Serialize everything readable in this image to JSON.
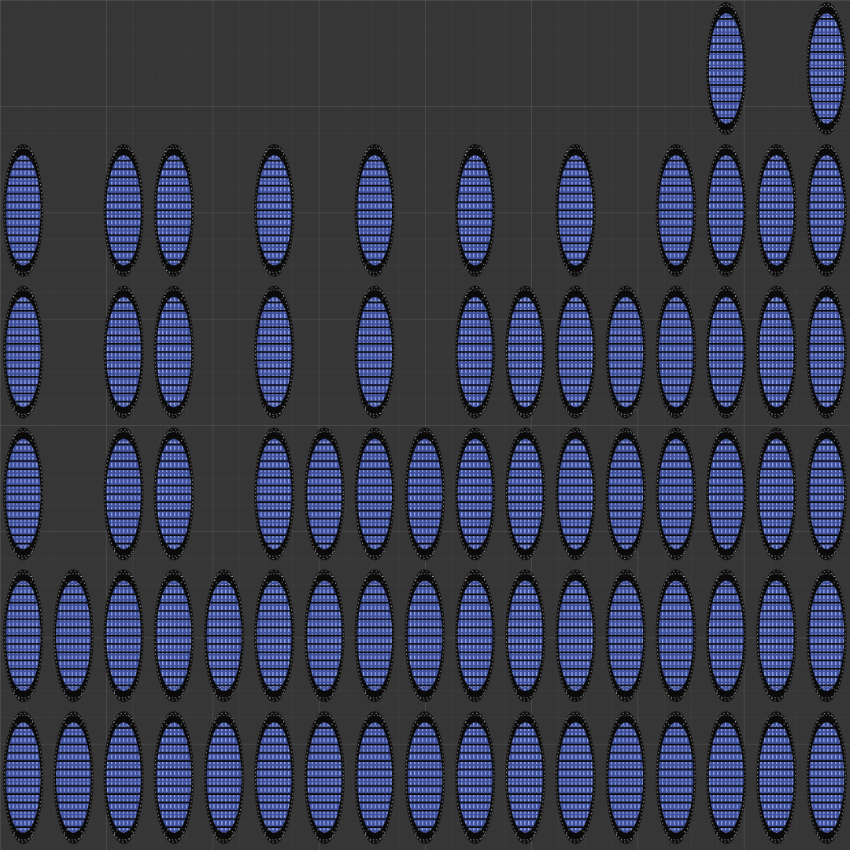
{
  "editor": {
    "name": "uv-editor",
    "background": "#363636",
    "grid_color": "#4a4a4a"
  },
  "island_style": {
    "fill_color": "#3f4f9a",
    "stripe_color": "#7f95d8",
    "edge_color": "#0a0a0a",
    "vertex_color": "#e0e0e0"
  },
  "island_rows": [
    {
      "row": 1,
      "occupied_columns": [
        15,
        17
      ]
    },
    {
      "row": 2,
      "occupied_columns": [
        1,
        3,
        4,
        6,
        8,
        10,
        12,
        14,
        15,
        16,
        17
      ]
    },
    {
      "row": 3,
      "occupied_columns": [
        1,
        3,
        4,
        6,
        8,
        10,
        11,
        12,
        13,
        14,
        15,
        16,
        17
      ]
    },
    {
      "row": 4,
      "occupied_columns": [
        1,
        3,
        4,
        6,
        7,
        8,
        9,
        10,
        11,
        12,
        13,
        14,
        15,
        16,
        17
      ]
    },
    {
      "row": 5,
      "occupied_columns": [
        1,
        2,
        3,
        4,
        5,
        6,
        7,
        8,
        9,
        10,
        11,
        12,
        13,
        14,
        15,
        16,
        17
      ]
    },
    {
      "row": 6,
      "occupied_columns": [
        1,
        2,
        3,
        4,
        5,
        6,
        7,
        8,
        9,
        10,
        11,
        12,
        13,
        14,
        15,
        16,
        17
      ]
    }
  ]
}
